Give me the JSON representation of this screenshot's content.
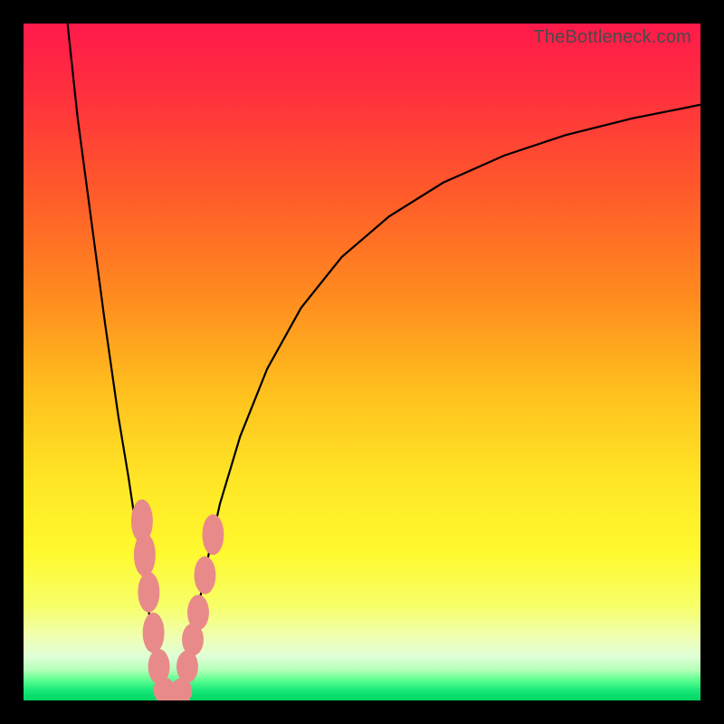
{
  "watermark": "TheBottleneck.com",
  "chart_data": {
    "type": "line",
    "title": "",
    "xlabel": "",
    "ylabel": "",
    "xlim": [
      0,
      100
    ],
    "ylim": [
      0,
      100
    ],
    "grid": false,
    "legend": false,
    "gradient_stops": [
      {
        "offset": 0.0,
        "color": "#ff1a4b"
      },
      {
        "offset": 0.1,
        "color": "#ff2f3e"
      },
      {
        "offset": 0.25,
        "color": "#ff5a2a"
      },
      {
        "offset": 0.4,
        "color": "#ff8a1f"
      },
      {
        "offset": 0.55,
        "color": "#ffc21e"
      },
      {
        "offset": 0.68,
        "color": "#ffe726"
      },
      {
        "offset": 0.78,
        "color": "#fff92e"
      },
      {
        "offset": 0.86,
        "color": "#f7ff68"
      },
      {
        "offset": 0.905,
        "color": "#f0ffb0"
      },
      {
        "offset": 0.935,
        "color": "#e0ffd8"
      },
      {
        "offset": 0.955,
        "color": "#b4ffb8"
      },
      {
        "offset": 0.97,
        "color": "#5cff90"
      },
      {
        "offset": 0.985,
        "color": "#18e878"
      },
      {
        "offset": 1.0,
        "color": "#00d564"
      }
    ],
    "series": [
      {
        "name": "left-branch",
        "color": "#000000",
        "x": [
          6.5,
          8,
          10,
          12,
          14,
          15.5,
          17,
          18.3,
          19.3,
          20.0,
          20.6,
          21.0
        ],
        "y": [
          100,
          86,
          71,
          56,
          42,
          33,
          23,
          14.5,
          8.0,
          4.0,
          1.5,
          0.0
        ]
      },
      {
        "name": "right-branch",
        "color": "#000000",
        "x": [
          23.0,
          23.6,
          24.4,
          25.5,
          27.0,
          29.0,
          32,
          36,
          41,
          47,
          54,
          62,
          71,
          80,
          90,
          100
        ],
        "y": [
          0.0,
          2.0,
          6.0,
          12.0,
          20.0,
          29.0,
          39.0,
          49.0,
          58.0,
          65.5,
          71.5,
          76.5,
          80.5,
          83.5,
          86.0,
          88.0
        ]
      }
    ],
    "markers": {
      "name": "pink-dots",
      "color": "#e98a8a",
      "points": [
        {
          "x": 17.5,
          "y": 26.5,
          "rx": 1.6,
          "ry": 3.2
        },
        {
          "x": 17.9,
          "y": 21.5,
          "rx": 1.6,
          "ry": 3.2
        },
        {
          "x": 18.5,
          "y": 16.0,
          "rx": 1.6,
          "ry": 3.0
        },
        {
          "x": 19.2,
          "y": 10.0,
          "rx": 1.6,
          "ry": 3.0
        },
        {
          "x": 20.0,
          "y": 5.0,
          "rx": 1.6,
          "ry": 2.6
        },
        {
          "x": 20.8,
          "y": 1.5,
          "rx": 1.6,
          "ry": 1.9
        },
        {
          "x": 22.0,
          "y": 0.4,
          "rx": 2.2,
          "ry": 1.5
        },
        {
          "x": 23.3,
          "y": 1.4,
          "rx": 1.6,
          "ry": 1.9
        },
        {
          "x": 24.2,
          "y": 5.0,
          "rx": 1.6,
          "ry": 2.4
        },
        {
          "x": 25.0,
          "y": 9.0,
          "rx": 1.6,
          "ry": 2.4
        },
        {
          "x": 25.8,
          "y": 13.0,
          "rx": 1.6,
          "ry": 2.6
        },
        {
          "x": 26.8,
          "y": 18.5,
          "rx": 1.6,
          "ry": 2.8
        },
        {
          "x": 28.0,
          "y": 24.5,
          "rx": 1.6,
          "ry": 3.0
        }
      ]
    }
  }
}
